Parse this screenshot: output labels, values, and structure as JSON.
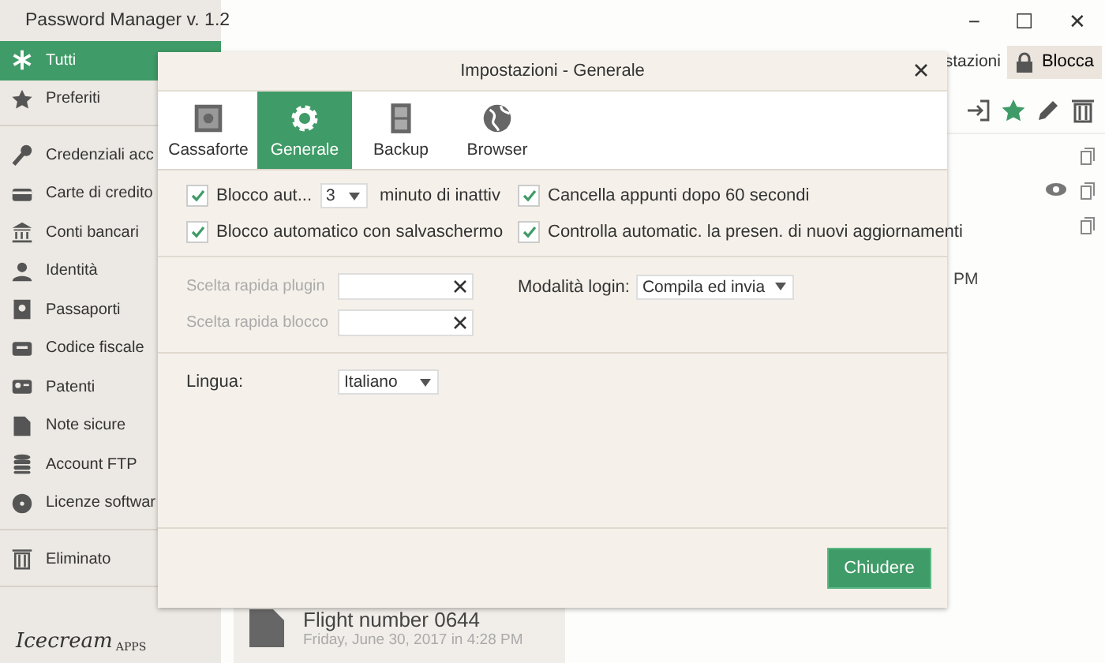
{
  "window": {
    "title": "Password Manager v. 1.2",
    "controls": [
      "−",
      "☐",
      "✕"
    ]
  },
  "sidebar": {
    "groups": [
      [
        {
          "label": "Tutti",
          "selected": true
        },
        {
          "label": "Preferiti",
          "selected": false
        }
      ],
      [
        {
          "label": "Credenziali acc",
          "selected": false
        },
        {
          "label": "Carte di credito",
          "selected": false
        },
        {
          "label": "Conti bancari",
          "selected": false
        },
        {
          "label": "Identità",
          "selected": false
        },
        {
          "label": "Passaporti",
          "selected": false
        },
        {
          "label": "Codice fiscale",
          "selected": false
        },
        {
          "label": "Patenti",
          "selected": false
        },
        {
          "label": "Note sicure",
          "selected": false
        },
        {
          "label": "Account FTP",
          "selected": false
        },
        {
          "label": "Licenze softwar",
          "selected": false
        }
      ],
      [
        {
          "label": "Eliminato",
          "selected": false
        }
      ]
    ],
    "logo": {
      "name": "Icecream",
      "sub": "APPS"
    }
  },
  "toolbar": {
    "settings": "stazioni",
    "lock": "Blocca"
  },
  "entry": {
    "favorite": true,
    "time_fragment": "PM"
  },
  "card": {
    "title": "Flight number 0644",
    "date": "Friday, June 30, 2017 in 4:28 PM"
  },
  "dialog": {
    "title": "Impostazioni - Generale",
    "tabs": [
      {
        "label": "Cassaforte",
        "selected": false
      },
      {
        "label": "Generale",
        "selected": true
      },
      {
        "label": "Backup",
        "selected": false
      },
      {
        "label": "Browser",
        "selected": false
      }
    ],
    "options": [
      {
        "kind": "timeout",
        "label": "Blocco aut...",
        "value": "3",
        "suffix": "minuto di inattiv",
        "checked": true
      },
      {
        "kind": "check",
        "label": "Cancella appunti dopo 60 secondi",
        "checked": true
      },
      {
        "kind": "check",
        "label": "Blocco automatico con salvaschermo",
        "checked": true
      },
      {
        "kind": "check",
        "label": "Controlla automatic. la presen. di nuovi aggiornamenti",
        "checked": true
      }
    ],
    "shortcuts": [
      {
        "label": "Scelta rapida plugin",
        "disabled": true
      },
      {
        "label": "Scelta rapida blocco",
        "disabled": true
      }
    ],
    "login_mode": {
      "label": "Modalità login:",
      "value": "Compila ed invia"
    },
    "language": {
      "label": "Lingua:",
      "value": "Italiano"
    },
    "button": "Chiudere"
  }
}
